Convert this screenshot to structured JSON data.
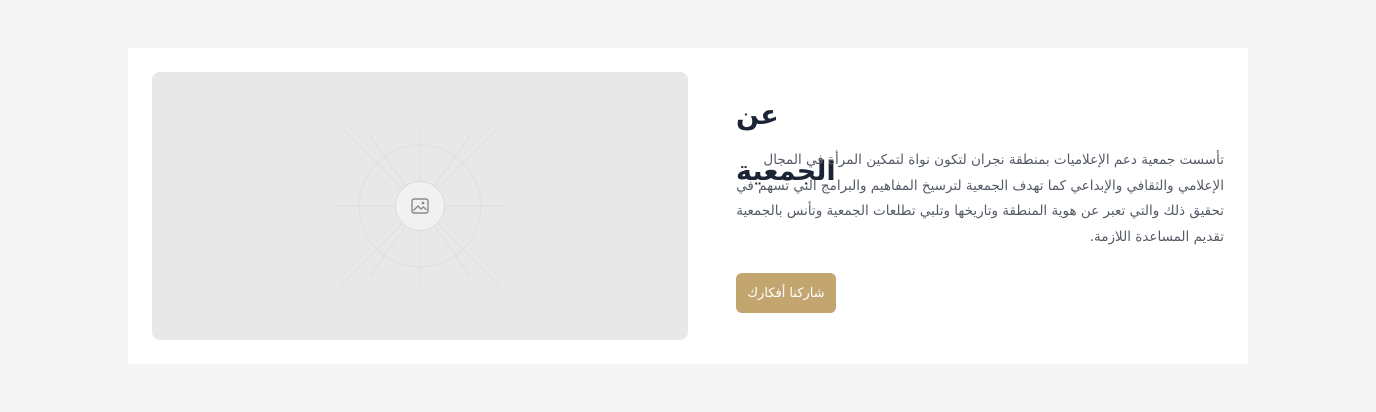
{
  "about": {
    "title": "عن الجمعية",
    "paragraph": "تأسست جمعية دعم الإعلاميات بمنطقة نجران لتكون نواة لتمكين المرأة في المجال الإعلامي والثقافي والإبداعي كما تهدف الجمعية لترسيخ المفاهيم والبرامج التي تسهم في تحقيق ذلك والتي تعبر عن هوية المنطقة وتاريخها وتلبي تطلعات الجمعية وتأنس بالجمعية تقديم المساعدة اللازمة.",
    "cta_label": "شاركنا أفكارك"
  },
  "media": {
    "icon": "image-icon"
  },
  "colors": {
    "page_bg": "#f5f5f5",
    "card_bg": "#ffffff",
    "placeholder_bg": "#e8e8e8",
    "title": "#1b2435",
    "text": "#555b66",
    "accent": "#c2a56f"
  }
}
